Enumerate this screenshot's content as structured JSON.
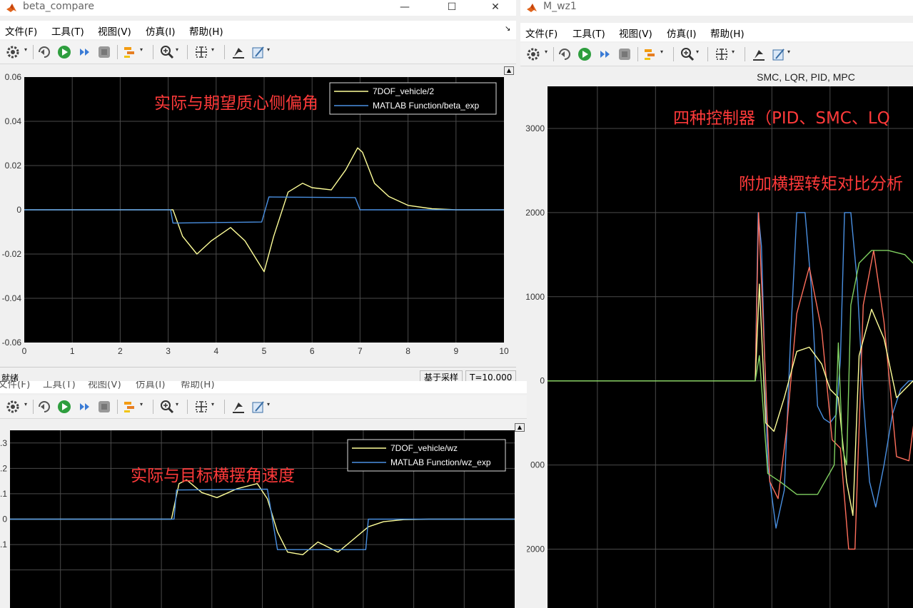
{
  "left_window": {
    "title": "beta_compare",
    "menu": [
      "文件(F)",
      "工具(T)",
      "视图(V)",
      "仿真(I)",
      "帮助(H)"
    ],
    "status": {
      "ready": "就绪",
      "sample_mode": "基于采样",
      "time": "T=10.000"
    }
  },
  "right_window": {
    "title": "M_wz1",
    "menu": [
      "文件(F)",
      "工具(T)",
      "视图(V)",
      "仿真(I)",
      "帮助(H)"
    ]
  },
  "bottom_window": {
    "menu": [
      "文件(F)",
      "工具(T)",
      "视图(V)",
      "仿真(I)",
      "帮助(H)"
    ]
  },
  "window_buttons": {
    "minimize": "—",
    "maximize": "☐",
    "close": "✕"
  },
  "icons": [
    "settings-icon",
    "step-back-icon",
    "run-icon",
    "step-forward-icon",
    "stop-icon",
    "highlight-icon",
    "zoom-icon",
    "fit-icon",
    "restore-icon",
    "style-icon"
  ],
  "colors": {
    "plot_bg": "#000000",
    "grid": "#4a4a4a",
    "yellow": "#ffff99",
    "blue": "#4a90e2",
    "red": "#ff6f5c",
    "green": "#80d060",
    "annot": "#ff3a3a"
  },
  "chart_data": [
    {
      "type": "line",
      "title": "",
      "annotation": "实际与期望质心侧偏角",
      "xlim": [
        0,
        10
      ],
      "ylim": [
        -0.06,
        0.06
      ],
      "xticks": [
        "0",
        "1",
        "2",
        "3",
        "4",
        "5",
        "6",
        "7",
        "8",
        "9",
        "10"
      ],
      "yticks": [
        "0.06",
        "0.04",
        "0.02",
        "0",
        "-0.02",
        "-0.04",
        "-0.06"
      ],
      "series": [
        {
          "name": "7DOF_vehicle/2",
          "color": "#ffff99",
          "x": [
            0,
            3,
            3.1,
            3.3,
            3.6,
            3.9,
            4.3,
            4.6,
            5.0,
            5.2,
            5.5,
            5.8,
            6.0,
            6.4,
            6.7,
            6.95,
            7.05,
            7.3,
            7.6,
            8.0,
            8.5,
            9.0,
            10
          ],
          "y": [
            0,
            0,
            0,
            -0.012,
            -0.02,
            -0.014,
            -0.008,
            -0.014,
            -0.028,
            -0.012,
            0.008,
            0.012,
            0.01,
            0.009,
            0.018,
            0.028,
            0.026,
            0.012,
            0.006,
            0.002,
            0.0005,
            0,
            0
          ]
        },
        {
          "name": "MATLAB Function/beta_exp",
          "color": "#4a90e2",
          "x": [
            0,
            3.05,
            3.1,
            4.95,
            5.1,
            6.9,
            7.0,
            10
          ],
          "y": [
            0,
            0,
            -0.006,
            -0.0055,
            0.0058,
            0.0055,
            0,
            0
          ]
        }
      ]
    },
    {
      "type": "line",
      "title": "SMC, LQR, PID, MPC",
      "annotation": "四种控制器（PID、SMC、LQ",
      "annotation2": "附加横摆转矩对比分析",
      "xlim": [
        0,
        10
      ],
      "ylim": [
        -2700,
        3500
      ],
      "yticks": [
        "3000",
        "2000",
        "1000",
        "0",
        "000",
        "2000"
      ],
      "series": [
        {
          "color": "#4a90e2",
          "x": [
            0,
            5.0,
            5.07,
            5.15,
            5.3,
            5.5,
            5.7,
            5.85,
            6.0,
            6.2,
            6.35,
            6.5,
            6.65,
            6.8,
            6.95,
            7.05,
            7.15,
            7.3,
            7.45,
            7.6,
            7.75,
            7.9,
            8.1,
            8.3,
            8.5,
            8.7,
            8.9,
            9.1,
            9.3
          ],
          "y": [
            0,
            0,
            2000,
            1600,
            -1000,
            -1750,
            -1300,
            500,
            2000,
            2000,
            1100,
            -300,
            -450,
            -500,
            -400,
            250,
            2000,
            2000,
            1200,
            -200,
            -1200,
            -1500,
            -1000,
            -400,
            -100,
            0,
            0,
            0,
            0
          ]
        },
        {
          "color": "#ff6f5c",
          "x": [
            0,
            5.0,
            5.08,
            5.2,
            5.35,
            5.55,
            5.75,
            6.0,
            6.3,
            6.6,
            6.85,
            7.05,
            7.25,
            7.4,
            7.6,
            7.85,
            8.1,
            8.4,
            8.7,
            9.0,
            9.3
          ],
          "y": [
            0,
            0,
            2000,
            600,
            -1200,
            -1400,
            -600,
            800,
            1350,
            600,
            -700,
            -800,
            -2000,
            -2000,
            900,
            1550,
            700,
            -900,
            -950,
            200,
            500
          ]
        },
        {
          "color": "#ffff99",
          "x": [
            0,
            5.0,
            5.1,
            5.25,
            5.45,
            5.7,
            6.0,
            6.3,
            6.6,
            6.8,
            7.0,
            7.2,
            7.35,
            7.5,
            7.8,
            8.1,
            8.4,
            8.7,
            9.0,
            9.3
          ],
          "y": [
            0,
            0,
            1150,
            -500,
            -600,
            -200,
            350,
            400,
            200,
            -100,
            -200,
            -1200,
            -1600,
            300,
            850,
            500,
            -200,
            -50,
            100,
            150
          ]
        },
        {
          "color": "#80d060",
          "x": [
            0,
            5.0,
            5.1,
            5.3,
            5.6,
            6.0,
            6.5,
            6.9,
            7.0,
            7.1,
            7.2,
            7.3,
            7.5,
            7.8,
            8.2,
            8.6,
            9.0,
            9.3
          ],
          "y": [
            0,
            0,
            300,
            -1100,
            -1200,
            -1350,
            -1350,
            -1000,
            450,
            -800,
            -1000,
            900,
            1400,
            1550,
            1550,
            1500,
            1300,
            900
          ]
        }
      ]
    },
    {
      "type": "line",
      "title": "",
      "annotation": "实际与目标横摆角速度",
      "xlim": [
        0,
        10
      ],
      "ylim": [
        -0.35,
        0.35
      ],
      "yticks": [
        ".3",
        ".2",
        ".1",
        "0",
        "-.1"
      ],
      "series": [
        {
          "name": "7DOF_vehicle/wz",
          "color": "#ffff99",
          "x": [
            0,
            3.2,
            3.35,
            3.5,
            3.8,
            4.1,
            4.5,
            4.9,
            5.1,
            5.3,
            5.5,
            5.8,
            6.1,
            6.5,
            6.8,
            7.1,
            7.4,
            7.8,
            8.3,
            10
          ],
          "y": [
            0,
            0,
            0.14,
            0.155,
            0.105,
            0.085,
            0.12,
            0.14,
            0.08,
            -0.05,
            -0.13,
            -0.14,
            -0.09,
            -0.13,
            -0.08,
            -0.03,
            -0.01,
            -0.002,
            0,
            0
          ]
        },
        {
          "name": "MATLAB Function/wz_exp",
          "color": "#4a90e2",
          "x": [
            0,
            3.25,
            3.3,
            5.1,
            5.3,
            7.05,
            7.1,
            10
          ],
          "y": [
            0,
            0,
            0.115,
            0.118,
            -0.12,
            -0.12,
            0,
            0
          ]
        }
      ]
    }
  ]
}
